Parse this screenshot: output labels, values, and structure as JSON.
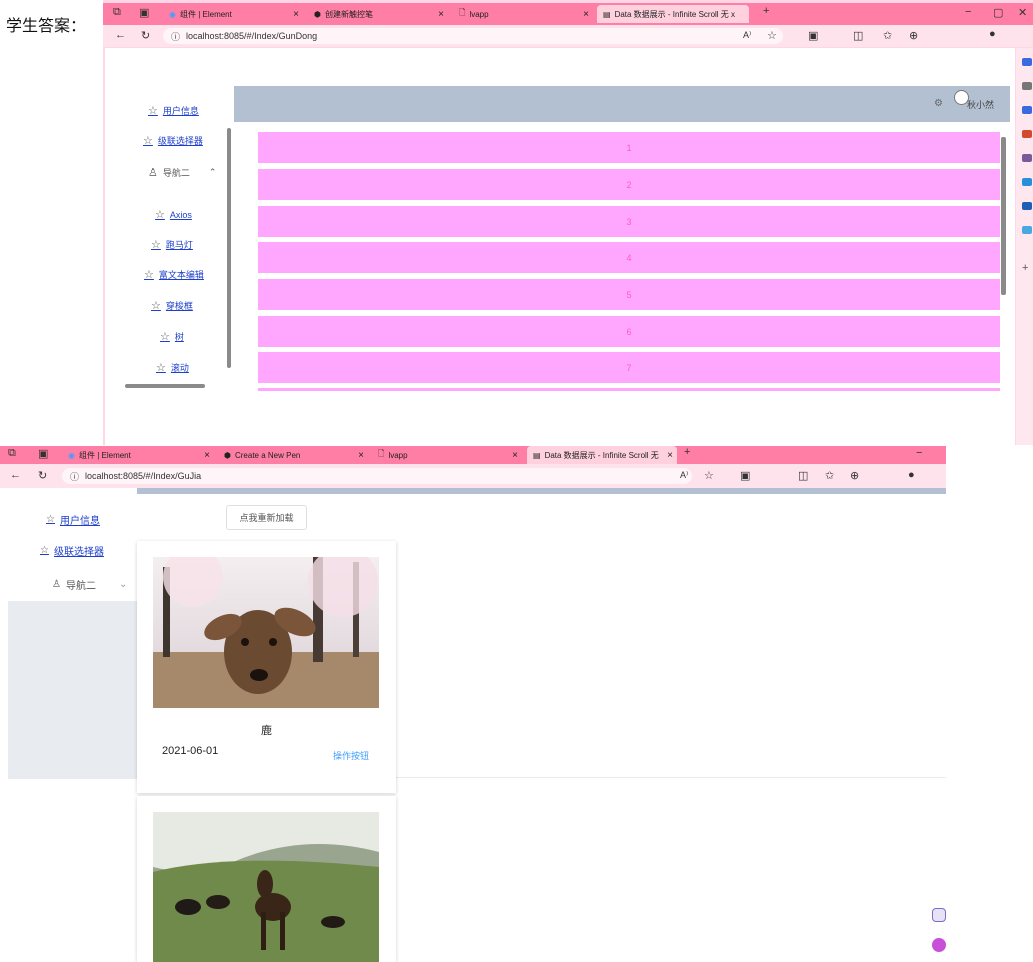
{
  "heading": "学生答案：",
  "win1": {
    "tabs": [
      "组件 | Element",
      "创建新触控笔",
      "lvapp",
      "Data 数据展示 - Infinite Scroll 无 x"
    ],
    "url": "localhost:8085/#/Index/GunDong",
    "header_user": "秋小然",
    "sidebar": {
      "items": [
        "用户信息",
        "级联选择器"
      ],
      "nav2": "导航二",
      "sub": [
        "Axios",
        "跑马灯",
        "富文本编辑",
        "穿梭框",
        "树",
        "滚动"
      ]
    },
    "list": [
      "1",
      "2",
      "3",
      "4",
      "5",
      "6",
      "7"
    ]
  },
  "win2": {
    "tabs": [
      "组件 | Element",
      "Create a New Pen",
      "lvapp",
      "Data 数据展示 - Infinite Scroll 无"
    ],
    "url": "localhost:8085/#/Index/GuJia",
    "sidebar": {
      "items": [
        "用户信息",
        "级联选择器"
      ],
      "nav2": "导航二"
    },
    "reload_button": "点我重新加载",
    "cards": [
      {
        "title": "鹿",
        "date": "2021-06-01",
        "action": "操作按钮"
      }
    ]
  }
}
